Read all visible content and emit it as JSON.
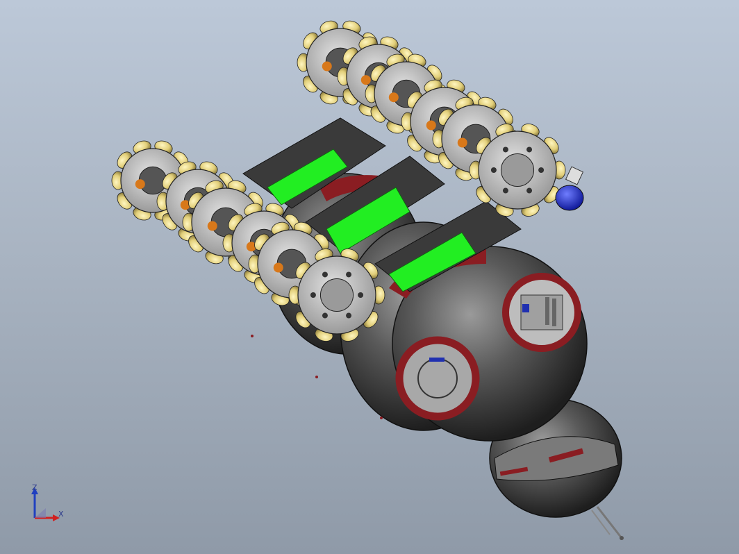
{
  "viewport": {
    "background_top": "#bcc8d8",
    "background_bottom": "#8f9aa8"
  },
  "model": {
    "wheel_color": "#c9c9c9",
    "roller_color": "#e6d58a",
    "beam_color": "#3a3a3a",
    "highlight_color": "#22ee22",
    "sphere_color": "#4a4a4a",
    "accent_color": "#8a1d22"
  },
  "triad": {
    "z_label": "Z",
    "x_label": "X",
    "x_color": "#d02020",
    "z_color": "#2040c0"
  }
}
